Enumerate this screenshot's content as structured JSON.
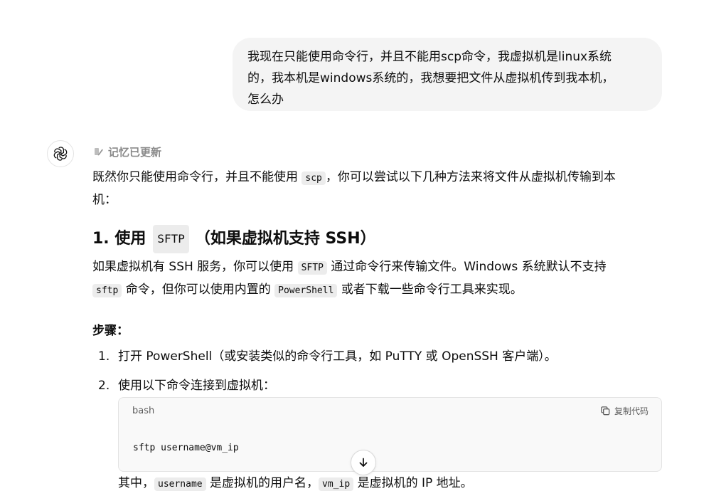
{
  "user_message": {
    "line1": "我现在只能使用命令行，并且不能用scp命令，我虚拟机是linux系统",
    "line2": "的，我本机是windows系统的，我想要把文件从虚拟机传到我本机，",
    "line3": "怎么办"
  },
  "assistant": {
    "avatar_icon": "openai-logo-icon",
    "memory_label": "记忆已更新",
    "intro": {
      "pre": "既然你只能使用命令行，并且不能使用",
      "code": "scp",
      "post": "，你可以尝试以下几种方法来将文件从虚拟机传输到本",
      "line2": "机："
    },
    "section1": {
      "prefix": "1. 使用",
      "code": "SFTP",
      "suffix": "（如果虚拟机支持 SSH）"
    },
    "para1": {
      "a": "如果虚拟机有 SSH 服务，你可以使用",
      "code1": "SFTP",
      "b": "通过命令行来传输文件。Windows 系统默认不支持",
      "code2": "sftp",
      "c": "命令，但你可以使用内置的",
      "code3": "PowerShell",
      "d": "或者下载一些命令行工具来实现。"
    },
    "steps_title": "步骤：",
    "steps": [
      {
        "num": "1.",
        "text": "打开 PowerShell（或安装类似的命令行工具，如 PuTTY 或 OpenSSH 客户端）。"
      },
      {
        "num": "2.",
        "text": "使用以下命令连接到虚拟机："
      }
    ],
    "code_block": {
      "lang": "bash",
      "copy_label": "复制代码",
      "code": "sftp username@vm_ip"
    },
    "note": {
      "a": "其中，",
      "code1": "username",
      "b": "是虚拟机的用户名，",
      "code2": "vm_ip",
      "c": "是虚拟机的 IP 地址。"
    }
  },
  "scroll_button_icon": "arrow-down-icon"
}
